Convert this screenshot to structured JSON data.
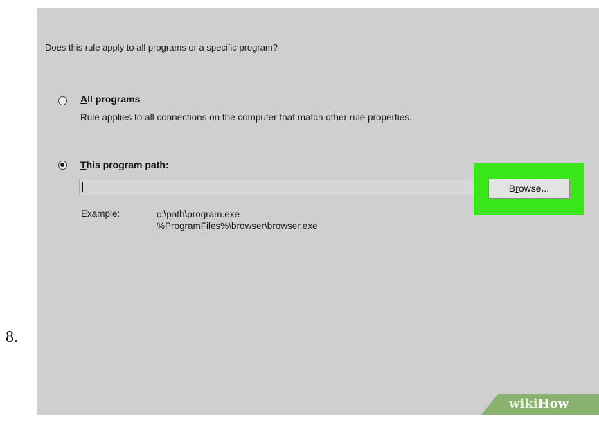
{
  "step": {
    "number": "8."
  },
  "dialog": {
    "question": "Does this rule apply to all programs or a specific program?",
    "options": [
      {
        "label_accel": "A",
        "label_rest": "ll programs",
        "description": "Rule applies to all connections on the computer that match other rule properties.",
        "selected": false
      },
      {
        "label_accel": "T",
        "label_rest": "his program path:",
        "selected": true
      }
    ],
    "path_input": {
      "value": ""
    },
    "browse_button": {
      "accel": "B",
      "mid": "r",
      "accel2": "o",
      "rest": "wse..."
    },
    "example": {
      "label": "Example:",
      "lines": [
        "c:\\path\\program.exe",
        "%ProgramFiles%\\browser\\browser.exe"
      ]
    }
  },
  "highlight": {
    "color": "#39e619"
  },
  "watermark": {
    "part1": "wiki",
    "part2": "How"
  }
}
